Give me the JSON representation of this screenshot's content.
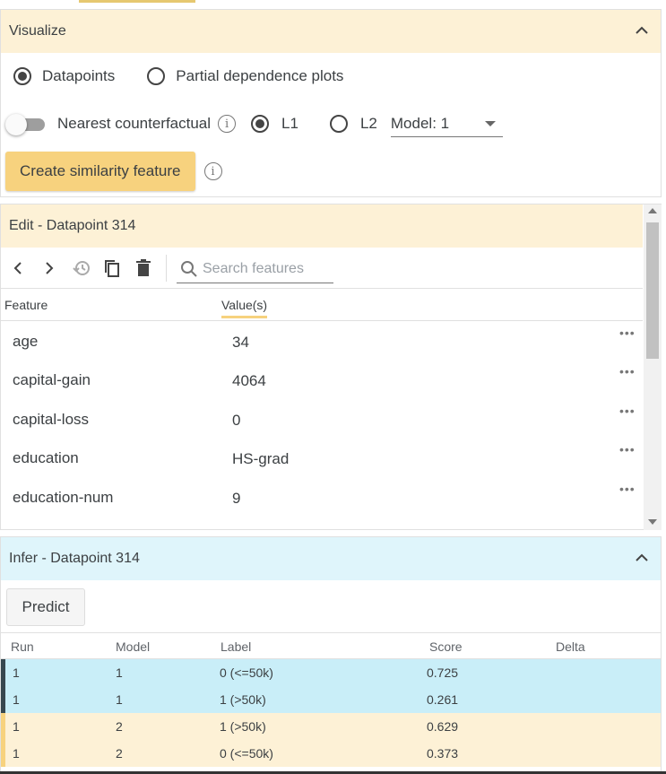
{
  "visualize": {
    "title": "Visualize",
    "radio_datapoints": "Datapoints",
    "radio_pdp": "Partial dependence plots",
    "nearest_cf_label": "Nearest counterfactual",
    "l1_label": "L1",
    "l2_label": "L2",
    "model_select_value": "Model: 1",
    "similarity_button": "Create similarity feature"
  },
  "edit": {
    "title": "Edit - Datapoint 314",
    "search_placeholder": "Search features",
    "col_feature": "Feature",
    "col_values": "Value(s)",
    "rows": [
      {
        "feature": "age",
        "value": "34"
      },
      {
        "feature": "capital-gain",
        "value": "4064"
      },
      {
        "feature": "capital-loss",
        "value": "0"
      },
      {
        "feature": "education",
        "value": "HS-grad"
      },
      {
        "feature": "education-num",
        "value": "9"
      }
    ],
    "row_menu": "•••"
  },
  "infer": {
    "title": "Infer - Datapoint 314",
    "predict_button": "Predict",
    "columns": [
      "Run",
      "Model",
      "Label",
      "Score",
      "Delta"
    ],
    "rows": [
      {
        "run": "1",
        "model": "1",
        "label": "0 (<=50k)",
        "score": "0.725",
        "delta": ""
      },
      {
        "run": "1",
        "model": "1",
        "label": "1 (>50k)",
        "score": "0.261",
        "delta": ""
      },
      {
        "run": "1",
        "model": "2",
        "label": "1 (>50k)",
        "score": "0.629",
        "delta": ""
      },
      {
        "run": "1",
        "model": "2",
        "label": "0 (<=50k)",
        "score": "0.373",
        "delta": ""
      }
    ]
  },
  "colors": {
    "visualize_header": "#fdf1d6",
    "infer_header": "#dff5fb",
    "model1_row": "#c9eef8",
    "model2_row": "#fdf1d6",
    "model1_bar": "#37474f",
    "model2_bar": "#f7d27e",
    "accent": "#f7d27e"
  }
}
